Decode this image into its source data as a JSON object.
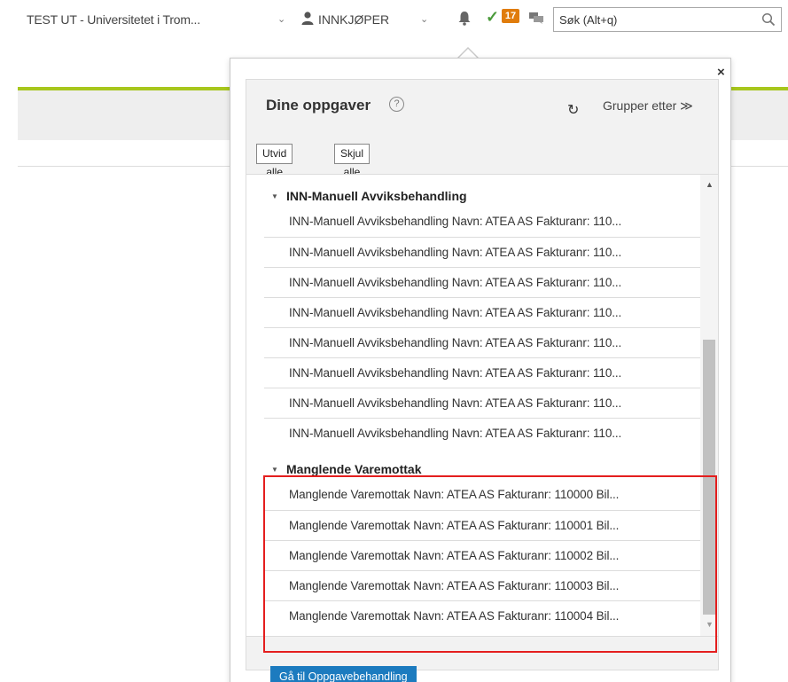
{
  "header": {
    "org_label": "TEST UT - Universitetet i Trom...",
    "role_label": "INNKJØPER",
    "task_count": "17",
    "search_placeholder": "Søk (Alt+q)"
  },
  "colors": {
    "accent_green": "#a7c61c",
    "badge_orange": "#e07c0c",
    "primary_blue": "#1c7bbf",
    "highlight_red": "#e41e1e"
  },
  "popup": {
    "close_label": "×",
    "title": "Dine oppgaver",
    "help_label": "?",
    "refresh_label": "↻",
    "group_by_label": "Grupper etter ≫",
    "expand_all_label": "Utvid alle",
    "collapse_all_label": "Skjul alle",
    "groups": [
      {
        "name": "INN-Manuell Avviksbehandling",
        "items": [
          "INN-Manuell Avviksbehandling Navn: ATEA AS Fakturanr: 110...",
          "INN-Manuell Avviksbehandling Navn: ATEA AS Fakturanr: 110...",
          "INN-Manuell Avviksbehandling Navn: ATEA AS Fakturanr: 110...",
          "INN-Manuell Avviksbehandling Navn: ATEA AS Fakturanr: 110...",
          "INN-Manuell Avviksbehandling Navn: ATEA AS Fakturanr: 110...",
          "INN-Manuell Avviksbehandling Navn: ATEA AS Fakturanr: 110...",
          "INN-Manuell Avviksbehandling Navn: ATEA AS Fakturanr: 110...",
          "INN-Manuell Avviksbehandling Navn: ATEA AS Fakturanr: 110..."
        ]
      },
      {
        "name": "Manglende Varemottak",
        "items": [
          "Manglende Varemottak Navn: ATEA AS Fakturanr: 110000 Bil...",
          "Manglende Varemottak Navn: ATEA AS Fakturanr: 110001 Bil...",
          "Manglende Varemottak Navn: ATEA AS Fakturanr: 110002 Bil...",
          "Manglende Varemottak Navn: ATEA AS Fakturanr: 110003 Bil...",
          "Manglende Varemottak Navn: ATEA AS Fakturanr: 110004 Bil..."
        ]
      }
    ],
    "goto_label": "Gå til Oppgavebehandling"
  }
}
